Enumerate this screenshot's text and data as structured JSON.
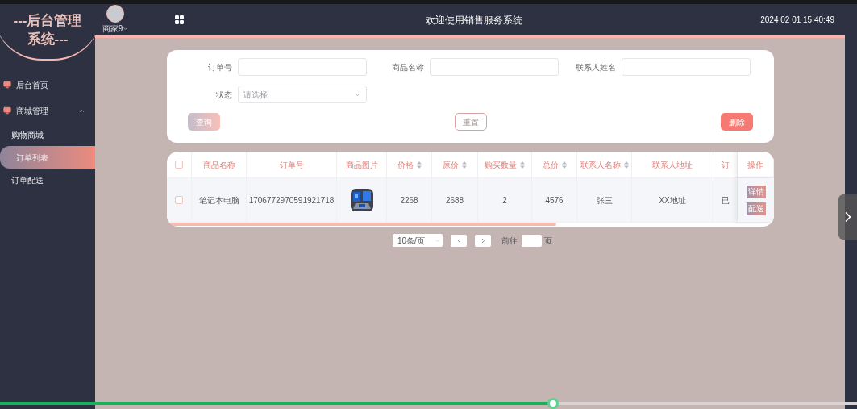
{
  "sidebar": {
    "logo_lines": [
      "---后台管理",
      "系统---"
    ],
    "items": [
      {
        "label": "后台首页",
        "kind": "top",
        "selected": false
      },
      {
        "label": "商城管理",
        "kind": "group",
        "expanded": true,
        "children": [
          {
            "label": "购物商城",
            "selected": false
          },
          {
            "label": "订单列表",
            "selected": true
          },
          {
            "label": "订单配送",
            "selected": false
          }
        ]
      }
    ]
  },
  "header": {
    "user": "商家9",
    "title": "欢迎使用销售服务系统",
    "datetime": "2024 02 01 15:40:49"
  },
  "filters": [
    {
      "label": "订单号",
      "kind": "input"
    },
    {
      "label": "商品名称",
      "kind": "input"
    },
    {
      "label": "联系人姓名",
      "kind": "input"
    },
    {
      "label": "状态",
      "kind": "select",
      "placeholder": "请选择"
    }
  ],
  "buttons": [
    {
      "label": "查询",
      "kind": "gradient"
    },
    {
      "label": "重置",
      "kind": "outline"
    },
    {
      "label": "删除",
      "kind": "danger"
    }
  ],
  "table": {
    "columns": [
      {
        "label": "商品名称",
        "sortable": false
      },
      {
        "label": "订单号",
        "sortable": false
      },
      {
        "label": "商品图片",
        "sortable": false
      },
      {
        "label": "价格",
        "sortable": true
      },
      {
        "label": "原价",
        "sortable": true
      },
      {
        "label": "购买数量",
        "sortable": true
      },
      {
        "label": "总价",
        "sortable": true
      },
      {
        "label": "联系人名称",
        "sortable": true
      },
      {
        "label": "联系人地址",
        "sortable": false
      },
      {
        "label": "订",
        "sortable": false
      },
      {
        "label": "操作",
        "sortable": false
      }
    ],
    "header_checked": false,
    "rows": [
      {
        "checked": false,
        "cells": [
          "笔记本电脑",
          "1706772970591921718",
          {
            "kind": "picture"
          },
          "2268",
          "2688",
          "2",
          "4576",
          "张三",
          "XX地址",
          "已"
        ],
        "actions": [
          "详情",
          "配送"
        ]
      }
    ]
  },
  "pagination": {
    "page_size": "10条/页",
    "goto_label": "前往",
    "page_suffix": "页"
  },
  "video": {
    "level": 0.645
  }
}
